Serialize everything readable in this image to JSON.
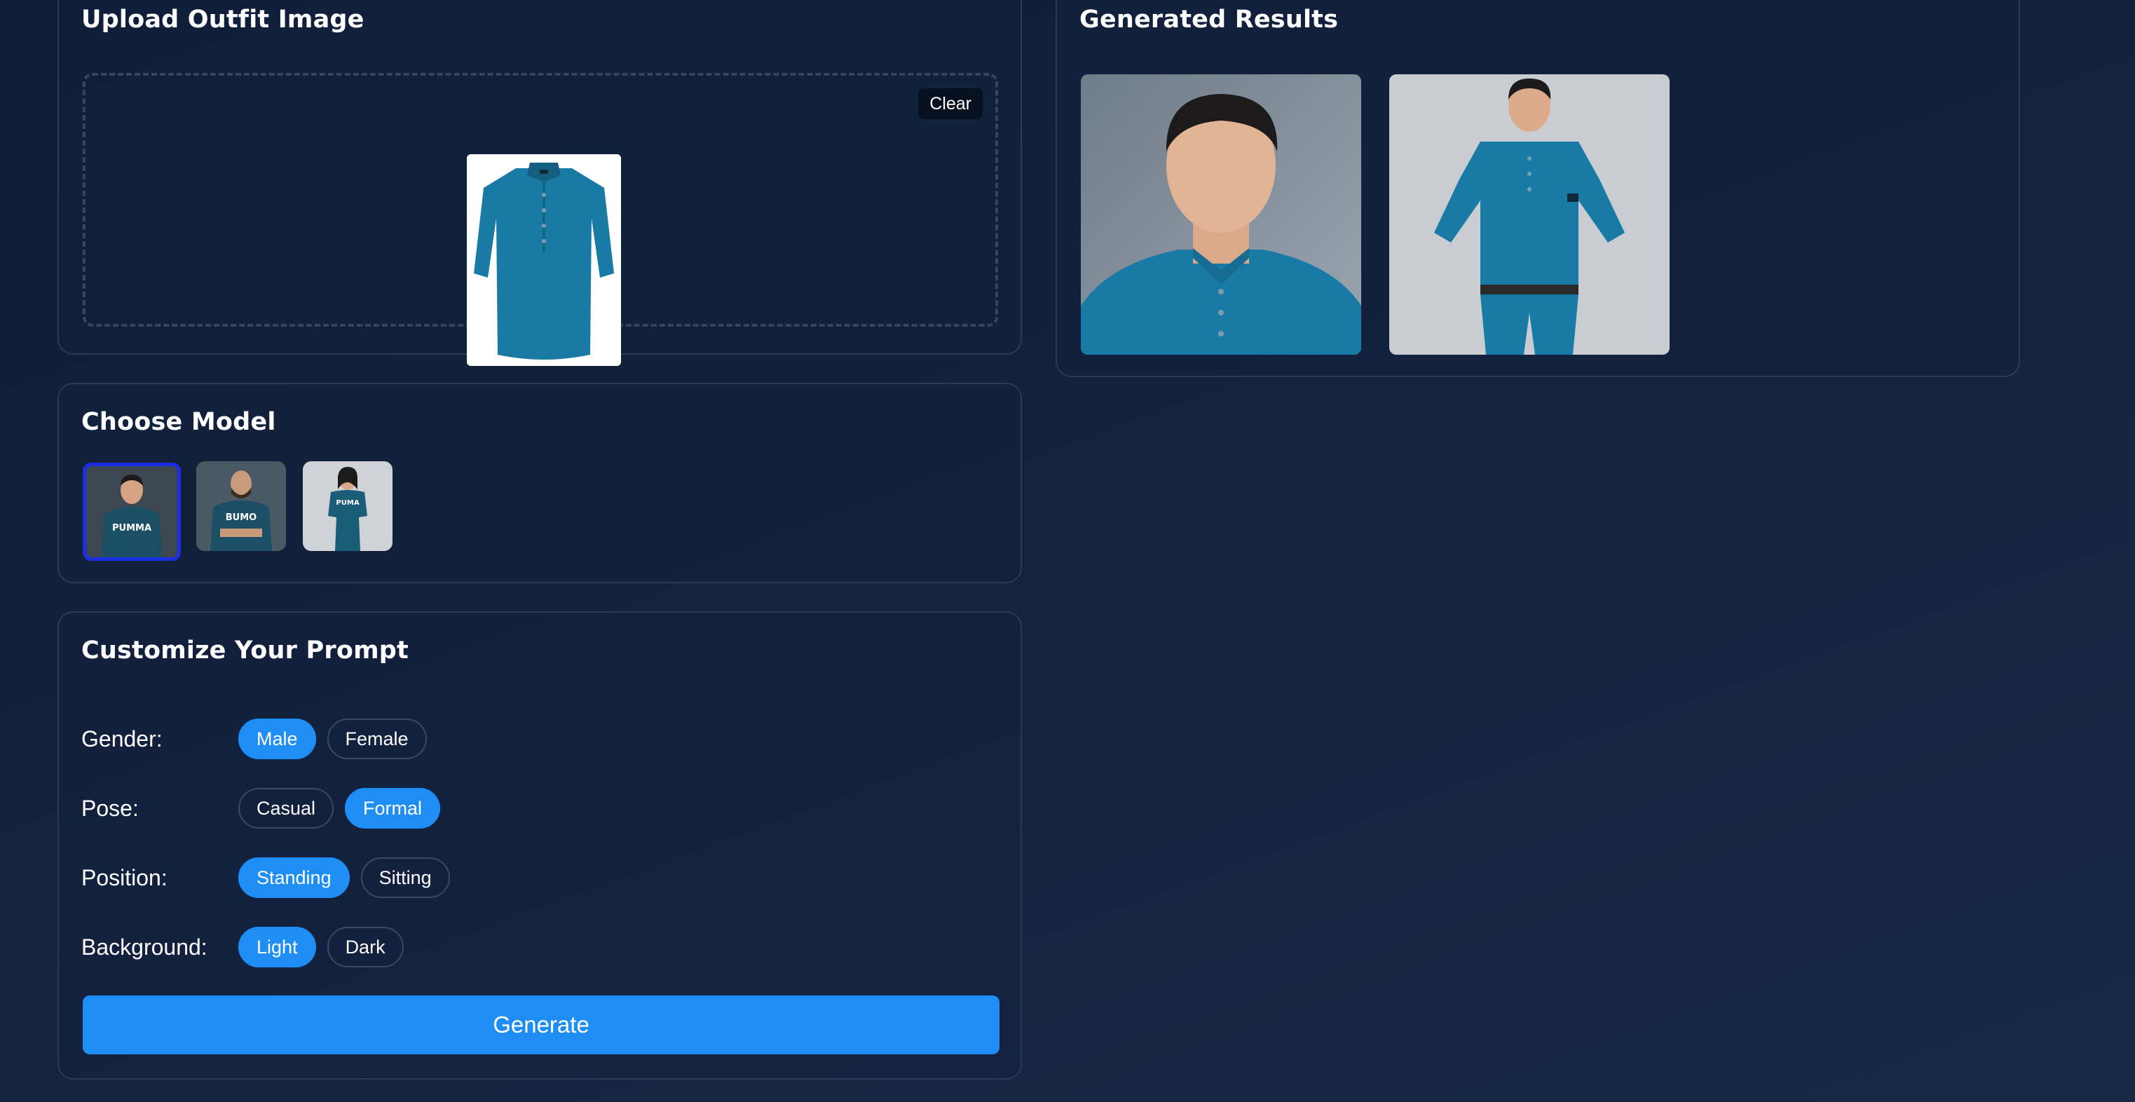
{
  "upload": {
    "title": "Upload Outfit Image",
    "clear_label": "Clear",
    "image": "teal-mandarin-collar-shirt"
  },
  "results": {
    "title": "Generated Results",
    "images": [
      "man-teal-shirt-portrait",
      "man-teal-shirt-full-body"
    ]
  },
  "models": {
    "title": "Choose Model",
    "items": [
      {
        "image": "man-teal-tshirt-model",
        "selected": true
      },
      {
        "image": "bearded-man-teal-tshirt-model",
        "selected": false
      },
      {
        "image": "woman-teal-dress-model",
        "selected": false
      }
    ]
  },
  "prompt": {
    "title": "Customize Your Prompt",
    "rows": [
      {
        "label": "Gender:",
        "options": [
          "Male",
          "Female"
        ],
        "selected": "Male"
      },
      {
        "label": "Pose:",
        "options": [
          "Casual",
          "Formal"
        ],
        "selected": "Formal"
      },
      {
        "label": "Position:",
        "options": [
          "Standing",
          "Sitting"
        ],
        "selected": "Standing"
      },
      {
        "label": "Background:",
        "options": [
          "Light",
          "Dark"
        ],
        "selected": "Light"
      }
    ],
    "generate_label": "Generate"
  },
  "colors": {
    "accent": "#1e8ef5",
    "selected_border": "#1b2ee6",
    "shirt": "#1a7aa6"
  }
}
